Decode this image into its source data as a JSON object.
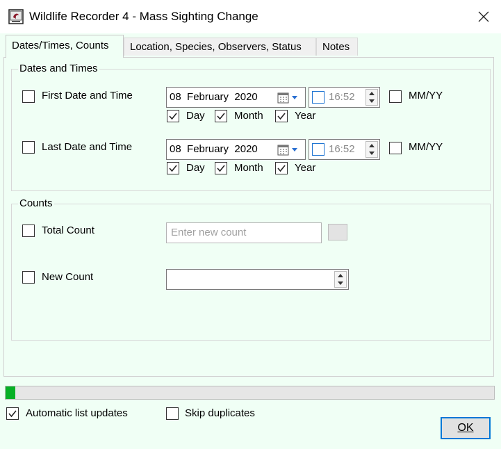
{
  "window": {
    "title": "Wildlife Recorder 4 - Mass Sighting Change",
    "app_icon": "wildlife-recorder-icon",
    "close_icon": "close-icon"
  },
  "tabs": [
    {
      "label": "Dates/Times, Counts",
      "active": true
    },
    {
      "label": "Location, Species, Observers, Status",
      "active": false
    },
    {
      "label": "Notes",
      "active": false
    }
  ],
  "dates_group": {
    "label": "Dates and Times",
    "first": {
      "label": "First Date and Time",
      "checked": false,
      "date_day": "08",
      "date_month": "February",
      "date_year": "2020",
      "time": "16:52",
      "mmyy_label": "MM/YY",
      "day_label": "Day",
      "month_label": "Month",
      "year_label": "Year"
    },
    "last": {
      "label": "Last Date and Time",
      "checked": false,
      "date_day": "08",
      "date_month": "February",
      "date_year": "2020",
      "time": "16:52",
      "mmyy_label": "MM/YY",
      "day_label": "Day",
      "month_label": "Month",
      "year_label": "Year"
    }
  },
  "counts_group": {
    "label": "Counts",
    "total_count_label": "Total Count",
    "total_count_placeholder": "Enter new count",
    "new_count_label": "New Count",
    "new_count_value": ""
  },
  "progress": 0.002,
  "footer": {
    "auto_updates_label": "Automatic list updates",
    "auto_updates_checked": true,
    "skip_duplicates_label": "Skip duplicates",
    "skip_duplicates_checked": false,
    "ok_label": "OK"
  },
  "colors": {
    "background": "#f0fff5",
    "progress_fill": "#06b025",
    "focus_blue": "#0078d7"
  }
}
